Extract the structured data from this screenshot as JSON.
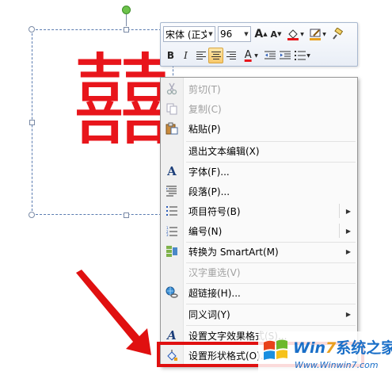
{
  "canvas": {
    "text_box_text": "囍"
  },
  "mini_toolbar": {
    "font_name": "宋体 (正文",
    "font_size": "96",
    "grow_font_icon": "A",
    "shrink_font_icon": "A",
    "bold": "B",
    "italic": "I",
    "font_color_letter": "A",
    "accent_colors": {
      "font_color": "#e8151b",
      "highlight_color": "#e8151b",
      "outline_color": "#e8a020"
    }
  },
  "context_menu": {
    "items": [
      {
        "label": "剪切(T)",
        "icon": "scissors-icon",
        "disabled": true
      },
      {
        "label": "复制(C)",
        "icon": "copy-icon",
        "disabled": true
      },
      {
        "label": "粘贴(P)",
        "icon": "paste-icon",
        "disabled": false
      },
      {
        "label": "退出文本编辑(X)",
        "icon": "",
        "disabled": false
      },
      {
        "label": "字体(F)...",
        "icon": "font-icon",
        "disabled": false
      },
      {
        "label": "段落(P)...",
        "icon": "paragraph-icon",
        "disabled": false
      },
      {
        "label": "项目符号(B)",
        "icon": "bullets-icon",
        "disabled": false,
        "submenu": true
      },
      {
        "label": "编号(N)",
        "icon": "numbering-icon",
        "disabled": false,
        "submenu": true
      },
      {
        "label": "转换为 SmartArt(M)",
        "icon": "smartart-icon",
        "disabled": false,
        "submenu": true
      },
      {
        "label": "汉字重选(V)",
        "icon": "",
        "disabled": true
      },
      {
        "label": "超链接(H)...",
        "icon": "hyperlink-icon",
        "disabled": false
      },
      {
        "label": "同义词(Y)",
        "icon": "",
        "disabled": false,
        "submenu": true
      },
      {
        "label": "设置文字效果格式(S)...",
        "icon": "text-effects-icon",
        "disabled": false
      },
      {
        "label": "设置形状格式(O)...",
        "icon": "shape-format-icon",
        "disabled": false
      }
    ]
  },
  "annotation": {
    "highlight_color": "#e01010"
  },
  "watermark": {
    "title_part1": "Win",
    "title_part2": "7",
    "title_part3": "系统之家",
    "url": "Www.Winwin7.com"
  }
}
